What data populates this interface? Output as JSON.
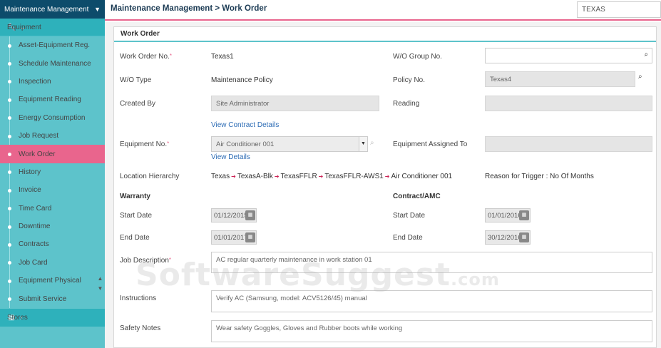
{
  "sidebar": {
    "app_title": "Maintenance Management",
    "section": "Equipment",
    "items": [
      {
        "label": "Asset-Equipment Reg."
      },
      {
        "label": "Schedule Maintenance"
      },
      {
        "label": "Inspection"
      },
      {
        "label": "Equipment Reading"
      },
      {
        "label": "Energy Consumption"
      },
      {
        "label": "Job Request"
      },
      {
        "label": "Work Order"
      },
      {
        "label": "History"
      },
      {
        "label": "Invoice"
      },
      {
        "label": "Time Card"
      },
      {
        "label": "Downtime"
      },
      {
        "label": "Contracts"
      },
      {
        "label": "Job Card"
      },
      {
        "label": "Equipment Physical"
      },
      {
        "label": "Submit Service"
      }
    ],
    "active_item": "Work Order",
    "bottom_section": "Stores"
  },
  "header": {
    "breadcrumb": "Maintenance Management > Work Order",
    "search_value": "TEXAS"
  },
  "form": {
    "title": "Work Order",
    "work_order_no_label": "Work Order No.",
    "work_order_no": "Texas1",
    "wo_group_label": "W/O Group No.",
    "wo_group_value": "",
    "wo_type_label": "W/O Type",
    "wo_type": "Maintenance Policy",
    "policy_no_label": "Policy No.",
    "policy_no": "Texas4",
    "created_by_label": "Created By",
    "created_by": "Site Administrator",
    "reading_label": "Reading",
    "reading": "",
    "view_contract_link": "View Contract Details",
    "equipment_no_label": "Equipment No.",
    "equipment_no": "Air Conditioner 001",
    "view_details_link": "View Details",
    "equipment_assigned_label": "Equipment Assigned To",
    "equipment_assigned": "",
    "location_label": "Location Hierarchy",
    "location_path": [
      "Texas",
      "TexasA-Blk",
      "TexasFFLR",
      "TexasFFLR-AWS1",
      "Air Conditioner 001"
    ],
    "trigger_text": "Reason for Trigger : No Of Months",
    "warranty_heading": "Warranty",
    "contract_heading": "Contract/AMC",
    "start_date_label": "Start Date",
    "end_date_label": "End Date",
    "warranty_start": "01/12/2015",
    "warranty_end": "01/01/2017",
    "contract_start": "01/01/2016",
    "contract_end": "30/12/2016",
    "job_description_label": "Job Description",
    "job_description": "AC regular quarterly maintenance in work station 01",
    "instructions_label": "Instructions",
    "instructions": "Verify AC (Samsung, model: ACV5126/45) manual",
    "safety_notes_label": "Safety Notes",
    "safety_notes": "Wear safety Goggles, Gloves and Rubber boots while working"
  },
  "watermark": {
    "main": "SoftwareSuggest",
    "suffix": ".com"
  },
  "colors": {
    "sidebar": "#5dc3cb",
    "active": "#e9658d",
    "header_dark": "#0d4c6b"
  }
}
